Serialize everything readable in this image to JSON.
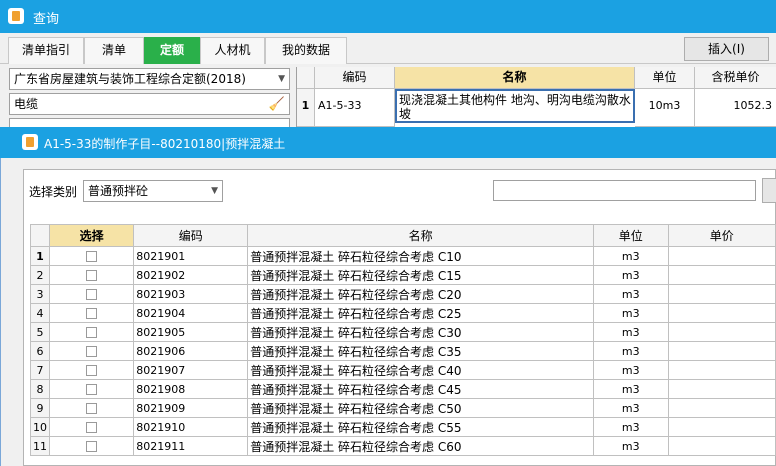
{
  "window": {
    "title": "查询"
  },
  "tabs": [
    "清单指引",
    "清单",
    "定额",
    "人材机",
    "我的数据"
  ],
  "insert_label": "插入(I)",
  "quota_combo": "广东省房屋建筑与装饰工程综合定额(2018)",
  "search_value": "电缆",
  "result_grid": {
    "headers": {
      "code": "编码",
      "name": "名称",
      "unit": "单位",
      "price": "含税单价"
    },
    "row": {
      "num": "1",
      "code": "A1-5-33",
      "name": "现浇混凝土其他构件 地沟、明沟电缆沟散水坡",
      "unit": "10m3",
      "price": "1052.3"
    }
  },
  "dialog": {
    "title": "A1-5-33的制作子目--80210180|预拌混凝土",
    "category_label": "选择类别",
    "category_value": "普通预拌砼",
    "headers": {
      "select": "选择",
      "code": "编码",
      "name": "名称",
      "unit": "单位",
      "price": "单价"
    },
    "rows": [
      {
        "num": "1",
        "code": "8021901",
        "name": "普通预拌混凝土 碎石粒径综合考虑 C10",
        "unit": "m3"
      },
      {
        "num": "2",
        "code": "8021902",
        "name": "普通预拌混凝土 碎石粒径综合考虑 C15",
        "unit": "m3"
      },
      {
        "num": "3",
        "code": "8021903",
        "name": "普通预拌混凝土 碎石粒径综合考虑 C20",
        "unit": "m3"
      },
      {
        "num": "4",
        "code": "8021904",
        "name": "普通预拌混凝土 碎石粒径综合考虑 C25",
        "unit": "m3"
      },
      {
        "num": "5",
        "code": "8021905",
        "name": "普通预拌混凝土 碎石粒径综合考虑 C30",
        "unit": "m3"
      },
      {
        "num": "6",
        "code": "8021906",
        "name": "普通预拌混凝土 碎石粒径综合考虑 C35",
        "unit": "m3"
      },
      {
        "num": "7",
        "code": "8021907",
        "name": "普通预拌混凝土 碎石粒径综合考虑 C40",
        "unit": "m3"
      },
      {
        "num": "8",
        "code": "8021908",
        "name": "普通预拌混凝土 碎石粒径综合考虑 C45",
        "unit": "m3"
      },
      {
        "num": "9",
        "code": "8021909",
        "name": "普通预拌混凝土 碎石粒径综合考虑 C50",
        "unit": "m3"
      },
      {
        "num": "10",
        "code": "8021910",
        "name": "普通预拌混凝土 碎石粒径综合考虑 C55",
        "unit": "m3"
      },
      {
        "num": "11",
        "code": "8021911",
        "name": "普通预拌混凝土 碎石粒径综合考虑 C60",
        "unit": "m3"
      }
    ]
  }
}
